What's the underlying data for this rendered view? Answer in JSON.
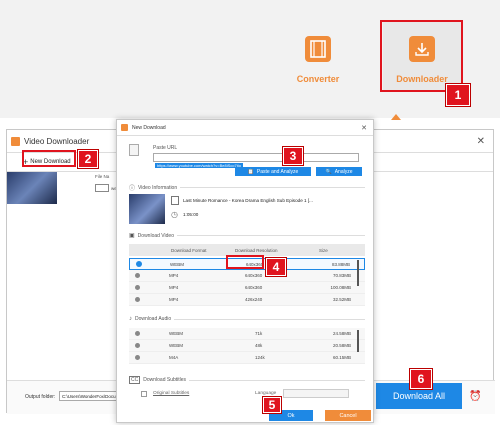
{
  "modes": {
    "converter": "Converter",
    "downloader": "Downloader"
  },
  "callouts": [
    "1",
    "2",
    "3",
    "4",
    "5",
    "6"
  ],
  "main_window": {
    "title": "Video Downloader",
    "new_download": "New Download",
    "file_name_label": "File Na",
    "file_row_text": "webm",
    "output_label": "Output folder:",
    "output_path": "C:\\Users\\WonderFox\\Docu",
    "download_all": "Download All"
  },
  "dialog": {
    "title": "New Download",
    "paste_url_label": "Paste URL",
    "url_value": "https://www.youtube.com/watch?v=Be8iSco7tio",
    "paste_analyze": "Paste and Analyze",
    "analyze": "Analyze",
    "video_info_label": "Video Information",
    "video_title": "Last Minute Romance - Korea Drama  English Sub Episode 1 [...",
    "duration": "1:05:00",
    "download_video_label": "Download Video",
    "video_headers": [
      "Download Format",
      "Download Resolution",
      "Size"
    ],
    "video_rows": [
      {
        "format": "WEBM",
        "resolution": "640x360",
        "size": "83.88MB",
        "selected": true
      },
      {
        "format": "MP4",
        "resolution": "640x360",
        "size": "70.83MB",
        "selected": false
      },
      {
        "format": "MP4",
        "resolution": "640x360",
        "size": "100.08MB",
        "selected": false
      },
      {
        "format": "MP4",
        "resolution": "426x240",
        "size": "32.52MB",
        "selected": false
      }
    ],
    "download_audio_label": "Download Audio",
    "audio_rows": [
      {
        "format": "WEBM",
        "bitrate": "71k",
        "size": "24.58MB"
      },
      {
        "format": "WEBM",
        "bitrate": "48k",
        "size": "20.58MB"
      },
      {
        "format": "M4A",
        "bitrate": "124k",
        "size": "60.15MB"
      }
    ],
    "download_subtitles_label": "Download Subtitles",
    "original_subtitles": "Original Subtitles",
    "language_label": "Language",
    "ok": "Ok",
    "cancel": "Cancel"
  },
  "colors": {
    "accent_orange": "#f08c3a",
    "callout_red": "#e0141e",
    "button_blue": "#1e88e5"
  }
}
